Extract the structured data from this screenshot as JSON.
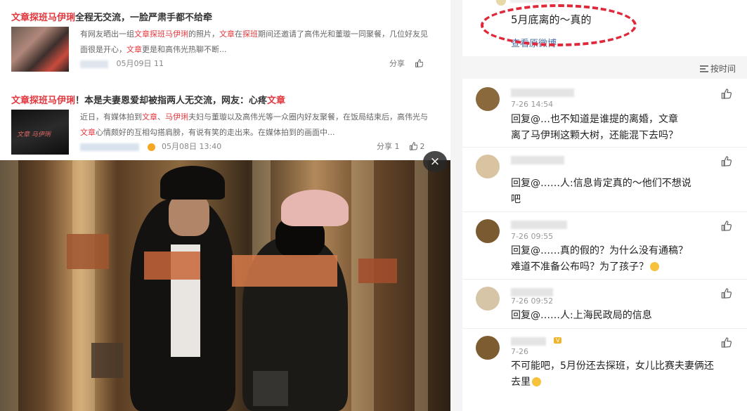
{
  "articles": [
    {
      "title_parts": [
        {
          "text": "文章探班马伊琍",
          "red": true
        },
        {
          "text": "全程无交流，一脸严肃手都不给牵",
          "red": false
        }
      ],
      "excerpt_line1_parts": [
        {
          "text": "有网友晒出一组",
          "red": false
        },
        {
          "text": "文章探班马伊琍",
          "red": true
        },
        {
          "text": "的照片，",
          "red": false
        },
        {
          "text": "文章",
          "red": true
        },
        {
          "text": "在",
          "red": false
        },
        {
          "text": "探班",
          "red": true
        },
        {
          "text": "期间还邀请了高伟光和董璇一同聚餐，几位好友见",
          "red": false
        }
      ],
      "excerpt_line2_parts": [
        {
          "text": "面很是开心，",
          "red": false
        },
        {
          "text": "文章",
          "red": true
        },
        {
          "text": "更是和高伟光热聊不断...",
          "red": false
        }
      ],
      "date": "05月09日 11",
      "share": "分享",
      "likes": ""
    },
    {
      "title_parts": [
        {
          "text": "文章探班马伊琍",
          "red": true
        },
        {
          "text": "！本是夫妻恩爱却被指两人无交流，网友：心疼",
          "red": false
        },
        {
          "text": "文章",
          "red": true
        }
      ],
      "excerpt_line1_parts": [
        {
          "text": "近日，有媒体拍到",
          "red": false
        },
        {
          "text": "文章",
          "red": true
        },
        {
          "text": "、",
          "red": false
        },
        {
          "text": "马伊琍",
          "red": true
        },
        {
          "text": "夫妇与董璇以及高伟光等一众圈内好友聚餐，在饭局结束后，高伟光与",
          "red": false
        }
      ],
      "excerpt_line2_parts": [
        {
          "text": "文章",
          "red": true
        },
        {
          "text": "心情颇好的互相勾搭肩膀，有说有笑的走出来。在媒体拍到的画面中...",
          "red": false
        }
      ],
      "date": "05月08日 13:40",
      "share": "分享 1",
      "likes": "2"
    }
  ],
  "thumb2_caption": "文章 马伊琍",
  "photo": {
    "close_icon": "×",
    "stripes": [
      {
        "frac": 0.0,
        "w": 0.04
      },
      {
        "frac": 0.16,
        "w": 0.05
      },
      {
        "frac": 0.56,
        "w": 0.04
      },
      {
        "frac": 0.78,
        "w": 0.05
      },
      {
        "frac": 0.92,
        "w": 0.03
      }
    ]
  },
  "weibo": {
    "post_text": "5月底离的～真的",
    "post_link": "查看原微博",
    "sort_label": "按时间",
    "comments": [
      {
        "time": "7-26 14:54",
        "text_line1": "回复@…也不知道是谁提的离婚，文章",
        "text_line2": "离了马伊琍这颗大树，还能混下去吗？",
        "avatar_color": "#8a6a3c"
      },
      {
        "time": "",
        "text_line1": "回复@……人:信息肯定真的～他们不想说",
        "text_line2": "吧",
        "avatar_color": "#d9c4a2"
      },
      {
        "time": "7-26 09:55",
        "text_line1": "回复@……真的假的？为什么没有通稿？",
        "text_line2": "难道不准备公布吗？为了孩子？",
        "avatar_color": "#7a5a30"
      },
      {
        "time": "7-26 09:52",
        "text_line1": "回复@……人:上海民政局的信息",
        "text_line2": "",
        "avatar_color": "#d7c5a8"
      },
      {
        "time": "7-26",
        "text_line1": "不可能吧，5月份还去探班，女儿比赛夫妻俩还",
        "text_line2": "去里",
        "avatar_color": "#7d5c32"
      }
    ]
  }
}
